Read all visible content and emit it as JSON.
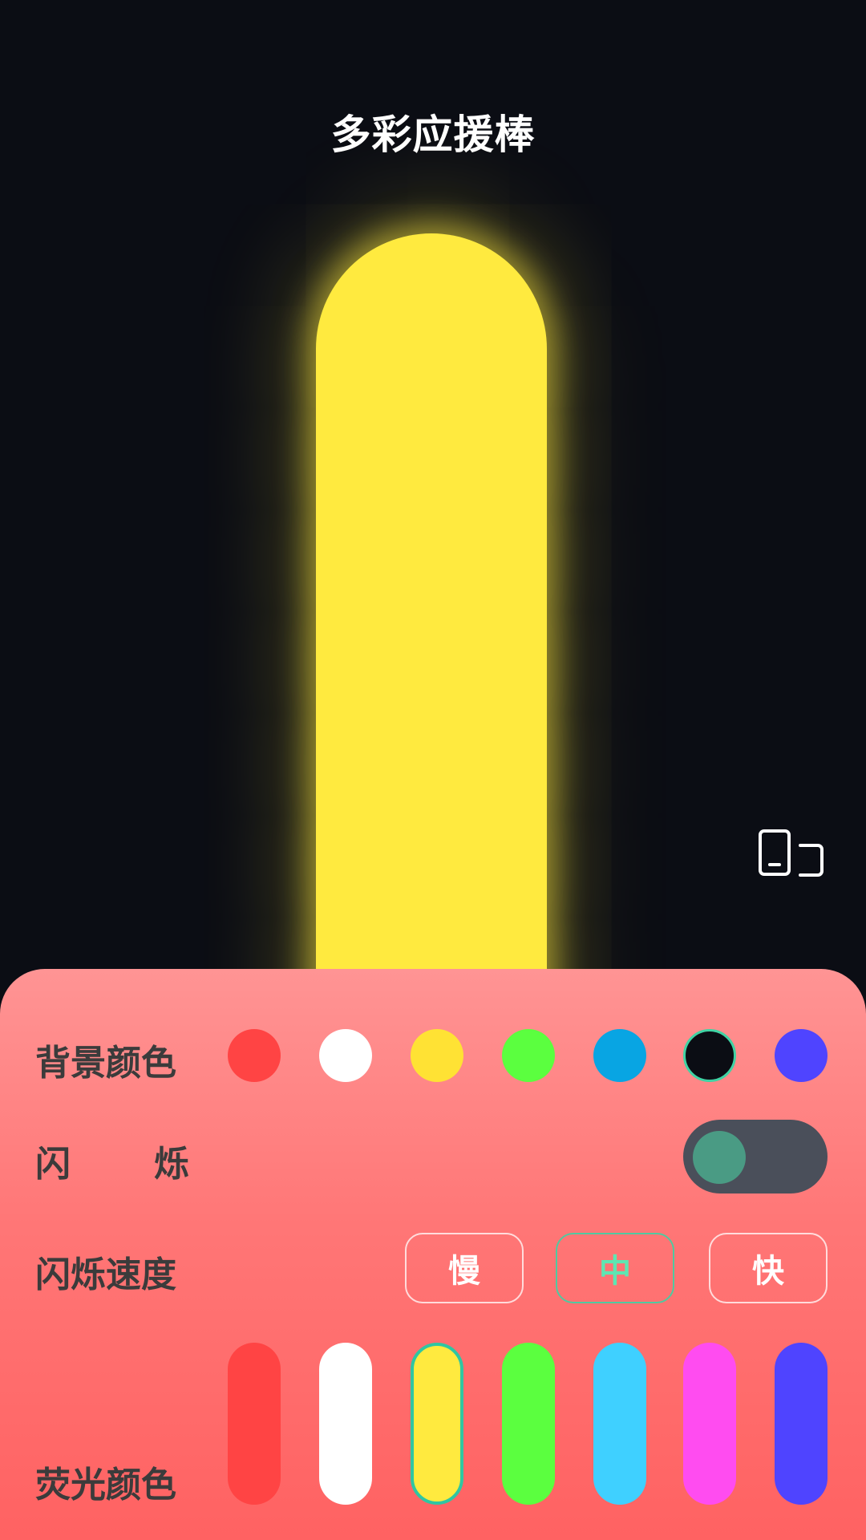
{
  "header": {
    "title": "多彩应援棒"
  },
  "stick": {
    "color": "#ffea3f"
  },
  "icons": {
    "rotate": "screen-rotate-icon"
  },
  "panel": {
    "background_label": "背景颜色",
    "flash_label": "闪烁",
    "flash_on": false,
    "speed_label": "闪烁速度",
    "glow_label": "荧光颜色",
    "background_colors": [
      "#ff4444",
      "#ffffff",
      "#ffe234",
      "#5bff3f",
      "#08a5e3",
      "#0b0d14",
      "#4f44ff"
    ],
    "background_selected_index": 5,
    "speed_options": [
      "慢",
      "中",
      "快"
    ],
    "speed_selected_index": 1,
    "glow_colors": [
      "#ff4444",
      "#ffffff",
      "#ffea3f",
      "#5bff3f",
      "#3fd0ff",
      "#ff4cf0",
      "#4f44ff"
    ],
    "glow_selected_index": 2
  }
}
